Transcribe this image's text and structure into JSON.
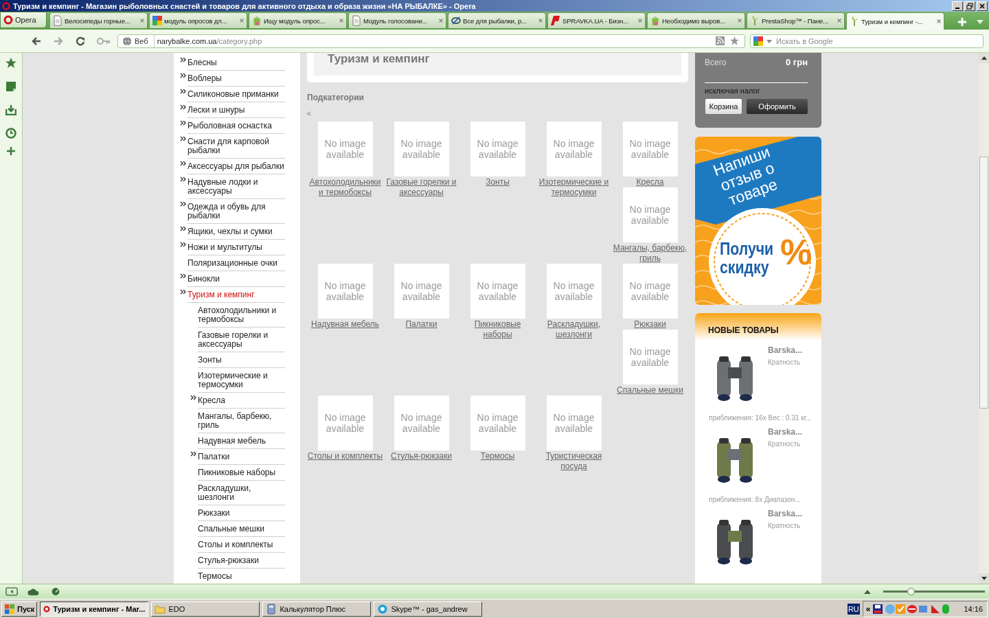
{
  "window": {
    "title": "Туризм и кемпинг - Магазин рыболовных снастей и товаров для активного отдыха и образа жизни «НА РЫБАЛКЕ» - Opera"
  },
  "menu_button": {
    "label": "Opera"
  },
  "tabs": [
    {
      "label": "Велосипеды горные...",
      "kind": "page",
      "selected": false
    },
    {
      "label": "модуль опросов дл...",
      "kind": "squares",
      "selected": false
    },
    {
      "label": "Ищу модуль опрос...",
      "kind": "bag",
      "selected": false
    },
    {
      "label": "Модуль голосовани...",
      "kind": "page",
      "selected": false
    },
    {
      "label": "Все для рыбалки, р...",
      "kind": "swirl",
      "selected": false
    },
    {
      "label": "SPRAVKA.UA - Бизн...",
      "kind": "slant",
      "selected": false
    },
    {
      "label": "Необходимо выров...",
      "kind": "bag",
      "selected": false
    },
    {
      "label": "PrestaShop™ - Пане...",
      "kind": "sprout",
      "selected": false
    },
    {
      "label": "Туризм и кемпинг -...",
      "kind": "sprout",
      "selected": true
    }
  ],
  "address_bar": {
    "badge": "Веб",
    "domain": "narybalke.com.ua",
    "path": "/category.php"
  },
  "search": {
    "placeholder": "Искать в Google"
  },
  "categories": [
    {
      "label": "Блесны",
      "arrow": true,
      "selected": false
    },
    {
      "label": "Воблеры",
      "arrow": true,
      "selected": false
    },
    {
      "label": "Силиконовые приманки",
      "arrow": true,
      "selected": false
    },
    {
      "label": "Лески и шнуры",
      "arrow": true,
      "selected": false
    },
    {
      "label": "Рыболовная оснастка",
      "arrow": true,
      "selected": false
    },
    {
      "label": "Снасти для карповой рыбалки",
      "arrow": true,
      "selected": false
    },
    {
      "label": "Аксессуары для рыбалки",
      "arrow": true,
      "selected": false
    },
    {
      "label": "Надувные лодки и аксессуары",
      "arrow": true,
      "selected": false
    },
    {
      "label": "Одежда и обувь для рыбалки",
      "arrow": true,
      "selected": false
    },
    {
      "label": "Ящики, чехлы и сумки",
      "arrow": true,
      "selected": false
    },
    {
      "label": "Ножи и мультитулы",
      "arrow": true,
      "selected": false
    },
    {
      "label": "Поляризационные очки",
      "arrow": false,
      "selected": false
    },
    {
      "label": "Бинокли",
      "arrow": true,
      "selected": false
    },
    {
      "label": "Туризм и кемпинг",
      "arrow": true,
      "selected": true,
      "children": [
        {
          "label": "Автохолодильники и термобоксы",
          "arrow": false,
          "selected": false
        },
        {
          "label": "Газовые горелки и аксессуары",
          "arrow": false,
          "selected": false
        },
        {
          "label": "Зонты",
          "arrow": false,
          "selected": false
        },
        {
          "label": "Изотермические и термосумки",
          "arrow": false,
          "selected": false
        },
        {
          "label": "Кресла",
          "arrow": true,
          "selected": false
        },
        {
          "label": "Мангалы, барбекю, гриль",
          "arrow": false,
          "selected": false
        },
        {
          "label": "Надувная мебель",
          "arrow": false,
          "selected": false
        },
        {
          "label": "Палатки",
          "arrow": true,
          "selected": false
        },
        {
          "label": "Пикниковые наборы",
          "arrow": false,
          "selected": false
        },
        {
          "label": "Раскладушки, шезлонги",
          "arrow": false,
          "selected": false
        },
        {
          "label": "Рюкзаки",
          "arrow": false,
          "selected": false
        },
        {
          "label": "Спальные мешки",
          "arrow": false,
          "selected": false
        },
        {
          "label": "Столы и комплекты",
          "arrow": false,
          "selected": false
        },
        {
          "label": "Стулья-рюкзаки",
          "arrow": false,
          "selected": false
        },
        {
          "label": "Термосы",
          "arrow": false,
          "selected": false
        }
      ]
    }
  ],
  "category_heading": "Туризм и кемпинг",
  "subcategories_title": "Подкатегории",
  "back_link": "<",
  "subcategory_rows": [
    [
      [
        {
          "name": "Автохолодильники и термобоксы",
          "image_text": "No image available"
        }
      ],
      [
        {
          "name": "Газовые горелки и аксессуары",
          "image_text": "No image available"
        }
      ],
      [
        {
          "name": "Зонты",
          "image_text": "No image available"
        }
      ],
      [
        {
          "name": "Изотермические и термосумки",
          "image_text": "No image available"
        }
      ],
      [
        {
          "name": "Кресла",
          "image_text": "No image available"
        },
        {
          "name": "Мангалы, барбекю, гриль",
          "image_text": "No image available"
        }
      ]
    ],
    [
      [
        {
          "name": "Надувная мебель",
          "image_text": "No image available"
        }
      ],
      [
        {
          "name": "Палатки",
          "image_text": "No image available"
        }
      ],
      [
        {
          "name": "Пикниковые наборы",
          "image_text": "No image available"
        }
      ],
      [
        {
          "name": "Раскладушки, шезлонги",
          "image_text": "No image available"
        }
      ],
      [
        {
          "name": "Рюкзаки",
          "image_text": "No image available"
        },
        {
          "name": "Спальные мешки",
          "image_text": "No image available"
        }
      ]
    ],
    [
      [
        {
          "name": "Столы и комплекты",
          "image_text": "No image available"
        }
      ],
      [
        {
          "name": "Стулья-рюкзаки",
          "image_text": "No image available"
        }
      ],
      [
        {
          "name": "Термосы",
          "image_text": "No image available"
        }
      ],
      [
        {
          "name": "Туристическая посуда",
          "image_text": "No image available"
        }
      ]
    ]
  ],
  "cart": {
    "total_label": "Всего",
    "total_value": "0 грн",
    "tax_note": "исключая налог",
    "buttons": [
      {
        "label": "Корзина",
        "kind": "secondary"
      },
      {
        "label": "Оформить",
        "kind": "primary"
      }
    ]
  },
  "banner": {
    "headline": "Напиши отзыв о товаре",
    "offer": "Получи скидку",
    "percent": "%"
  },
  "new_products": {
    "title": "НОВЫЕ ТОВАРЫ",
    "items": [
      {
        "name": "Barska...",
        "subtitle": "Кратность",
        "description": "приближения: 16x Вес : 0.31 кг..."
      },
      {
        "name": "Barska...",
        "subtitle": "Кратность",
        "description": "приближения: 8x Диапазон..."
      },
      {
        "name": "Barska...",
        "subtitle": "Кратность"
      }
    ]
  },
  "status_bar": {
    "zoom": {
      "level": 0.27
    }
  },
  "taskbar": {
    "start": "Пуск",
    "tasks": [
      {
        "label": "Туризм и кемпинг - Mar...",
        "kind": "opera",
        "selected": true
      },
      {
        "label": "EDO",
        "kind": "folder",
        "selected": false
      },
      {
        "label": "Калькулятор Плюс",
        "kind": "calculator",
        "selected": false
      },
      {
        "label": "Skype™ - gas_andrew",
        "kind": "chat",
        "selected": false
      }
    ],
    "language": "RU",
    "tray_toggle": "«",
    "clock": "14:16"
  }
}
